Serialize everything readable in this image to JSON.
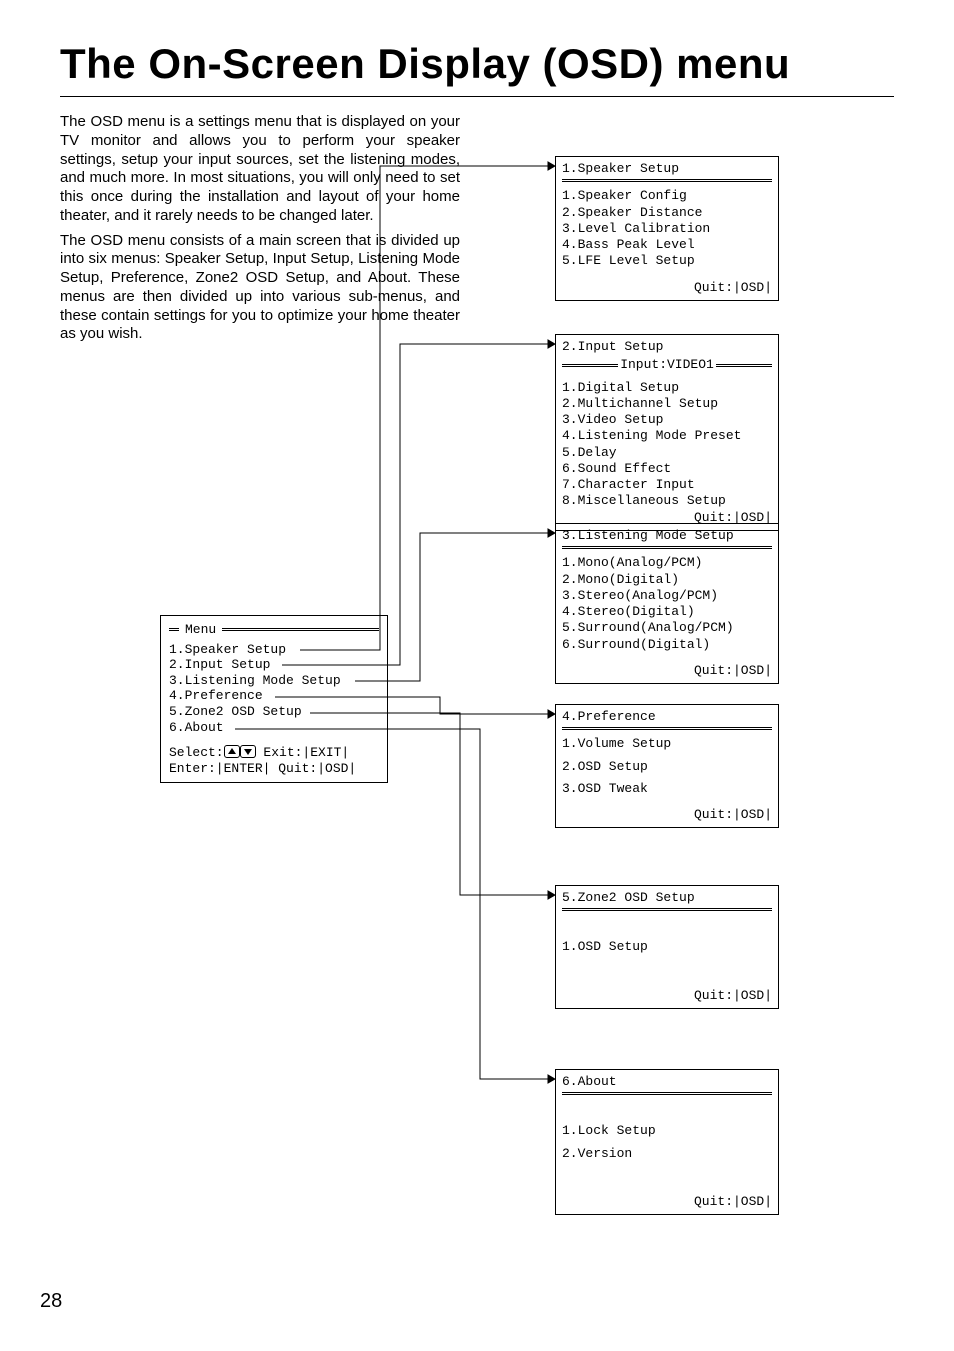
{
  "page_number": "28",
  "title": "The On-Screen Display (OSD) menu",
  "intro": {
    "p1": "The OSD menu is a settings menu that is displayed on your TV monitor and allows you to perform your speaker settings, setup your input sources, set the listening modes, and much more. In most situations, you will only need to set this once during the installation and layout of your home theater, and it rarely needs to be changed later.",
    "p2": "The OSD menu consists of a main screen that is divided up into six menus: Speaker Setup, Input Setup, Listening Mode Setup, Preference, Zone2 OSD Setup, and About. These menus are then divided up into various sub-menus, and these contain settings for you to optimize your home theater as you wish."
  },
  "main_menu": {
    "title": "Menu",
    "items": [
      "1.Speaker Setup",
      "2.Input Setup",
      "3.Listening Mode Setup",
      "4.Preference",
      "5.Zone2 OSD Setup",
      "6.About"
    ],
    "footer1_a": "Select:",
    "footer1_b": "  Exit:|EXIT|",
    "footer2": "Enter:|ENTER|  Quit:|OSD|"
  },
  "quit_label": "Quit:|OSD|",
  "subs": [
    {
      "title": "1.Speaker Setup",
      "banner": null,
      "items": [
        "1.Speaker Config",
        "2.Speaker Distance",
        "3.Level Calibration",
        "4.Bass Peak Level",
        "5.LFE Level Setup"
      ]
    },
    {
      "title": "2.Input Setup",
      "banner": "Input:VIDEO1",
      "items": [
        "1.Digital Setup",
        "2.Multichannel Setup",
        "3.Video Setup",
        "4.Listening Mode Preset",
        "5.Delay",
        "6.Sound Effect",
        "7.Character Input",
        "8.Miscellaneous Setup"
      ],
      "tight_quit": true
    },
    {
      "title": "3.Listening Mode Setup",
      "banner": null,
      "items": [
        "1.Mono(Analog/PCM)",
        "2.Mono(Digital)",
        "3.Stereo(Analog/PCM)",
        "4.Stereo(Digital)",
        "5.Surround(Analog/PCM)",
        "6.Surround(Digital)"
      ]
    },
    {
      "title": "4.Preference",
      "banner": null,
      "spaced": true,
      "items": [
        "1.Volume Setup",
        "2.OSD Setup",
        "3.OSD Tweak"
      ]
    },
    {
      "title": "5.Zone2 OSD Setup",
      "banner": null,
      "spaced": true,
      "pad_top": true,
      "items": [
        "1.OSD Setup"
      ]
    },
    {
      "title": "6.About",
      "banner": null,
      "spaced": true,
      "pad_top": true,
      "items": [
        "1.Lock Setup",
        "2.Version"
      ]
    }
  ]
}
